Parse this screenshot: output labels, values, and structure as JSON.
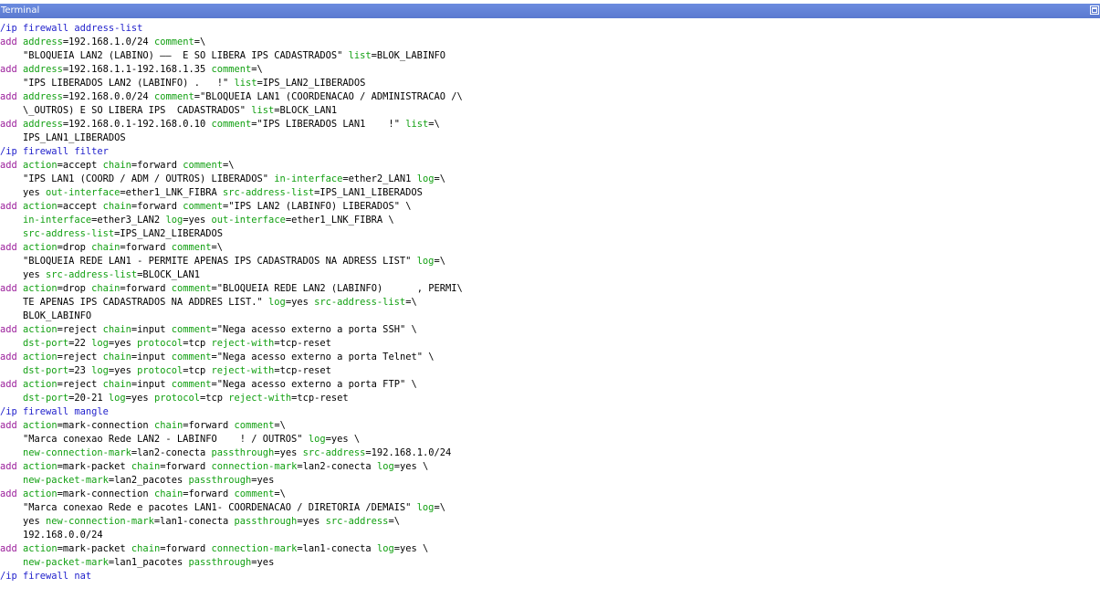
{
  "window": {
    "title": "Terminal",
    "maximize_icon": "maximize-icon"
  },
  "colors": {
    "titlebar": "#5a79d0",
    "path": "#2222cc",
    "command": "#9b1e9b",
    "attribute": "#12a012",
    "value": "#000000"
  },
  "terminal": {
    "lines": [
      [
        [
          "k",
          "/ip firewall address-list"
        ]
      ],
      [
        [
          "c",
          "add"
        ],
        [
          "t",
          " "
        ],
        [
          "a",
          "address"
        ],
        [
          "t",
          "=192.168.1.0/24 "
        ],
        [
          "a",
          "comment"
        ],
        [
          "t",
          "=\\"
        ]
      ],
      [
        [
          "t",
          "    \"BLOQUEIA LAN2 (LABINO) ——  E SO LIBERA IPS CADASTRADOS\" "
        ],
        [
          "a",
          "list"
        ],
        [
          "t",
          "=BLOK_LABINFO"
        ]
      ],
      [
        [
          "c",
          "add"
        ],
        [
          "t",
          " "
        ],
        [
          "a",
          "address"
        ],
        [
          "t",
          "=192.168.1.1-192.168.1.35 "
        ],
        [
          "a",
          "comment"
        ],
        [
          "t",
          "=\\"
        ]
      ],
      [
        [
          "t",
          "    \"IPS LIBERADOS LAN2 (LABINFO) .   !\" "
        ],
        [
          "a",
          "list"
        ],
        [
          "t",
          "=IPS_LAN2_LIBERADOS"
        ]
      ],
      [
        [
          "c",
          "add"
        ],
        [
          "t",
          " "
        ],
        [
          "a",
          "address"
        ],
        [
          "t",
          "=192.168.0.0/24 "
        ],
        [
          "a",
          "comment"
        ],
        [
          "t",
          "=\"BLOQUEIA LAN1 (COORDENACAO / ADMINISTRACAO /\\"
        ]
      ],
      [
        [
          "t",
          "    \\_OUTROS) E SO LIBERA IPS  CADASTRADOS\" "
        ],
        [
          "a",
          "list"
        ],
        [
          "t",
          "=BLOCK_LAN1"
        ]
      ],
      [
        [
          "c",
          "add"
        ],
        [
          "t",
          " "
        ],
        [
          "a",
          "address"
        ],
        [
          "t",
          "=192.168.0.1-192.168.0.10 "
        ],
        [
          "a",
          "comment"
        ],
        [
          "t",
          "=\"IPS LIBERADOS LAN1    !\" "
        ],
        [
          "a",
          "list"
        ],
        [
          "t",
          "=\\"
        ]
      ],
      [
        [
          "t",
          "    IPS_LAN1_LIBERADOS"
        ]
      ],
      [
        [
          "k",
          "/ip firewall filter"
        ]
      ],
      [
        [
          "c",
          "add"
        ],
        [
          "t",
          " "
        ],
        [
          "a",
          "action"
        ],
        [
          "t",
          "=accept "
        ],
        [
          "a",
          "chain"
        ],
        [
          "t",
          "=forward "
        ],
        [
          "a",
          "comment"
        ],
        [
          "t",
          "=\\"
        ]
      ],
      [
        [
          "t",
          "    \"IPS LAN1 (COORD / ADM / OUTROS) LIBERADOS\" "
        ],
        [
          "a",
          "in-interface"
        ],
        [
          "t",
          "=ether2_LAN1 "
        ],
        [
          "a",
          "log"
        ],
        [
          "t",
          "=\\"
        ]
      ],
      [
        [
          "t",
          "    yes "
        ],
        [
          "a",
          "out-interface"
        ],
        [
          "t",
          "=ether1_LNK_FIBRA "
        ],
        [
          "a",
          "src-address-list"
        ],
        [
          "t",
          "=IPS_LAN1_LIBERADOS"
        ]
      ],
      [
        [
          "c",
          "add"
        ],
        [
          "t",
          " "
        ],
        [
          "a",
          "action"
        ],
        [
          "t",
          "=accept "
        ],
        [
          "a",
          "chain"
        ],
        [
          "t",
          "=forward "
        ],
        [
          "a",
          "comment"
        ],
        [
          "t",
          "=\"IPS LAN2 (LABINFO) LIBERADOS\" \\"
        ]
      ],
      [
        [
          "t",
          "    "
        ],
        [
          "a",
          "in-interface"
        ],
        [
          "t",
          "=ether3_LAN2 "
        ],
        [
          "a",
          "log"
        ],
        [
          "t",
          "=yes "
        ],
        [
          "a",
          "out-interface"
        ],
        [
          "t",
          "=ether1_LNK_FIBRA \\"
        ]
      ],
      [
        [
          "t",
          "    "
        ],
        [
          "a",
          "src-address-list"
        ],
        [
          "t",
          "=IPS_LAN2_LIBERADOS"
        ]
      ],
      [
        [
          "c",
          "add"
        ],
        [
          "t",
          " "
        ],
        [
          "a",
          "action"
        ],
        [
          "t",
          "=drop "
        ],
        [
          "a",
          "chain"
        ],
        [
          "t",
          "=forward "
        ],
        [
          "a",
          "comment"
        ],
        [
          "t",
          "=\\"
        ]
      ],
      [
        [
          "t",
          "    \"BLOQUEIA REDE LAN1 - PERMITE APENAS IPS CADASTRADOS NA ADRESS LIST\" "
        ],
        [
          "a",
          "log"
        ],
        [
          "t",
          "=\\"
        ]
      ],
      [
        [
          "t",
          "    yes "
        ],
        [
          "a",
          "src-address-list"
        ],
        [
          "t",
          "=BLOCK_LAN1"
        ]
      ],
      [
        [
          "c",
          "add"
        ],
        [
          "t",
          " "
        ],
        [
          "a",
          "action"
        ],
        [
          "t",
          "=drop "
        ],
        [
          "a",
          "chain"
        ],
        [
          "t",
          "=forward "
        ],
        [
          "a",
          "comment"
        ],
        [
          "t",
          "=\"BLOQUEIA REDE LAN2 (LABINFO)      , PERMI\\"
        ]
      ],
      [
        [
          "t",
          "    TE APENAS IPS CADASTRADOS NA ADDRES LIST.\" "
        ],
        [
          "a",
          "log"
        ],
        [
          "t",
          "=yes "
        ],
        [
          "a",
          "src-address-list"
        ],
        [
          "t",
          "=\\"
        ]
      ],
      [
        [
          "t",
          "    BLOK_LABINFO"
        ]
      ],
      [
        [
          "c",
          "add"
        ],
        [
          "t",
          " "
        ],
        [
          "a",
          "action"
        ],
        [
          "t",
          "=reject "
        ],
        [
          "a",
          "chain"
        ],
        [
          "t",
          "=input "
        ],
        [
          "a",
          "comment"
        ],
        [
          "t",
          "=\"Nega acesso externo a porta SSH\" \\"
        ]
      ],
      [
        [
          "t",
          "    "
        ],
        [
          "a",
          "dst-port"
        ],
        [
          "t",
          "=22 "
        ],
        [
          "a",
          "log"
        ],
        [
          "t",
          "=yes "
        ],
        [
          "a",
          "protocol"
        ],
        [
          "t",
          "=tcp "
        ],
        [
          "a",
          "reject-with"
        ],
        [
          "t",
          "=tcp-reset"
        ]
      ],
      [
        [
          "c",
          "add"
        ],
        [
          "t",
          " "
        ],
        [
          "a",
          "action"
        ],
        [
          "t",
          "=reject "
        ],
        [
          "a",
          "chain"
        ],
        [
          "t",
          "=input "
        ],
        [
          "a",
          "comment"
        ],
        [
          "t",
          "=\"Nega acesso externo a porta Telnet\" \\"
        ]
      ],
      [
        [
          "t",
          "    "
        ],
        [
          "a",
          "dst-port"
        ],
        [
          "t",
          "=23 "
        ],
        [
          "a",
          "log"
        ],
        [
          "t",
          "=yes "
        ],
        [
          "a",
          "protocol"
        ],
        [
          "t",
          "=tcp "
        ],
        [
          "a",
          "reject-with"
        ],
        [
          "t",
          "=tcp-reset"
        ]
      ],
      [
        [
          "c",
          "add"
        ],
        [
          "t",
          " "
        ],
        [
          "a",
          "action"
        ],
        [
          "t",
          "=reject "
        ],
        [
          "a",
          "chain"
        ],
        [
          "t",
          "=input "
        ],
        [
          "a",
          "comment"
        ],
        [
          "t",
          "=\"Nega acesso externo a porta FTP\" \\"
        ]
      ],
      [
        [
          "t",
          "    "
        ],
        [
          "a",
          "dst-port"
        ],
        [
          "t",
          "=20-21 "
        ],
        [
          "a",
          "log"
        ],
        [
          "t",
          "=yes "
        ],
        [
          "a",
          "protocol"
        ],
        [
          "t",
          "=tcp "
        ],
        [
          "a",
          "reject-with"
        ],
        [
          "t",
          "=tcp-reset"
        ]
      ],
      [
        [
          "k",
          "/ip firewall mangle"
        ]
      ],
      [
        [
          "c",
          "add"
        ],
        [
          "t",
          " "
        ],
        [
          "a",
          "action"
        ],
        [
          "t",
          "=mark-connection "
        ],
        [
          "a",
          "chain"
        ],
        [
          "t",
          "=forward "
        ],
        [
          "a",
          "comment"
        ],
        [
          "t",
          "=\\"
        ]
      ],
      [
        [
          "t",
          "    \"Marca conexao Rede LAN2 - LABINFO    ! / OUTROS\" "
        ],
        [
          "a",
          "log"
        ],
        [
          "t",
          "=yes \\"
        ]
      ],
      [
        [
          "t",
          "    "
        ],
        [
          "a",
          "new-connection-mark"
        ],
        [
          "t",
          "=lan2-conecta "
        ],
        [
          "a",
          "passthrough"
        ],
        [
          "t",
          "=yes "
        ],
        [
          "a",
          "src-address"
        ],
        [
          "t",
          "=192.168.1.0/24"
        ]
      ],
      [
        [
          "c",
          "add"
        ],
        [
          "t",
          " "
        ],
        [
          "a",
          "action"
        ],
        [
          "t",
          "=mark-packet "
        ],
        [
          "a",
          "chain"
        ],
        [
          "t",
          "=forward "
        ],
        [
          "a",
          "connection-mark"
        ],
        [
          "t",
          "=lan2-conecta "
        ],
        [
          "a",
          "log"
        ],
        [
          "t",
          "=yes \\"
        ]
      ],
      [
        [
          "t",
          "    "
        ],
        [
          "a",
          "new-packet-mark"
        ],
        [
          "t",
          "=lan2_pacotes "
        ],
        [
          "a",
          "passthrough"
        ],
        [
          "t",
          "=yes"
        ]
      ],
      [
        [
          "c",
          "add"
        ],
        [
          "t",
          " "
        ],
        [
          "a",
          "action"
        ],
        [
          "t",
          "=mark-connection "
        ],
        [
          "a",
          "chain"
        ],
        [
          "t",
          "=forward "
        ],
        [
          "a",
          "comment"
        ],
        [
          "t",
          "=\\"
        ]
      ],
      [
        [
          "t",
          "    \"Marca conexao Rede e pacotes LAN1- COORDENACAO / DIRETORIA /DEMAIS\" "
        ],
        [
          "a",
          "log"
        ],
        [
          "t",
          "=\\"
        ]
      ],
      [
        [
          "t",
          "    yes "
        ],
        [
          "a",
          "new-connection-mark"
        ],
        [
          "t",
          "=lan1-conecta "
        ],
        [
          "a",
          "passthrough"
        ],
        [
          "t",
          "=yes "
        ],
        [
          "a",
          "src-address"
        ],
        [
          "t",
          "=\\"
        ]
      ],
      [
        [
          "t",
          "    192.168.0.0/24"
        ]
      ],
      [
        [
          "c",
          "add"
        ],
        [
          "t",
          " "
        ],
        [
          "a",
          "action"
        ],
        [
          "t",
          "=mark-packet "
        ],
        [
          "a",
          "chain"
        ],
        [
          "t",
          "=forward "
        ],
        [
          "a",
          "connection-mark"
        ],
        [
          "t",
          "=lan1-conecta "
        ],
        [
          "a",
          "log"
        ],
        [
          "t",
          "=yes \\"
        ]
      ],
      [
        [
          "t",
          "    "
        ],
        [
          "a",
          "new-packet-mark"
        ],
        [
          "t",
          "=lan1_pacotes "
        ],
        [
          "a",
          "passthrough"
        ],
        [
          "t",
          "=yes"
        ]
      ],
      [
        [
          "k",
          "/ip firewall nat"
        ]
      ]
    ]
  }
}
